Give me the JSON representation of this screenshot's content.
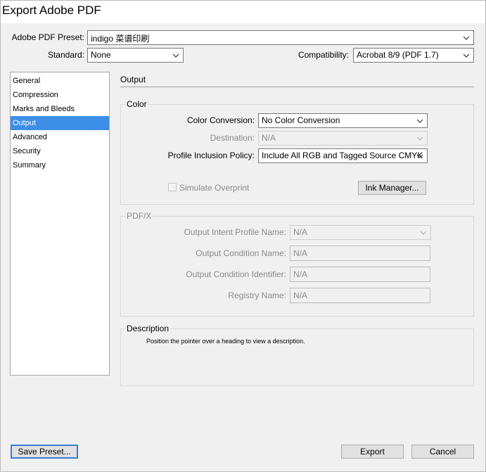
{
  "window": {
    "title": "Export Adobe PDF"
  },
  "top": {
    "preset_label": "Adobe PDF Preset:",
    "preset_value": "indigo 菜谱印刷",
    "standard_label": "Standard:",
    "standard_value": "None",
    "compat_label": "Compatibility:",
    "compat_value": "Acrobat 8/9 (PDF 1.7)"
  },
  "sidebar": {
    "items": [
      {
        "label": "General"
      },
      {
        "label": "Compression"
      },
      {
        "label": "Marks and Bleeds"
      },
      {
        "label": "Output"
      },
      {
        "label": "Advanced"
      },
      {
        "label": "Security"
      },
      {
        "label": "Summary"
      }
    ],
    "selected": "Output"
  },
  "main": {
    "section_title": "Output",
    "color": {
      "title": "Color",
      "conversion_label": "Color Conversion:",
      "conversion_value": "No Color Conversion",
      "destination_label": "Destination:",
      "destination_value": "N/A",
      "policy_label": "Profile Inclusion Policy:",
      "policy_value": "Include All RGB and Tagged Source CMYK",
      "simulate_label": "Simulate Overprint",
      "ink_button": "Ink Manager..."
    },
    "pdfx": {
      "title": "PDF/X",
      "intent_label": "Output Intent Profile Name:",
      "intent_value": "N/A",
      "cond_name_label": "Output Condition Name:",
      "cond_name_value": "N/A",
      "cond_id_label": "Output Condition Identifier:",
      "cond_id_value": "N/A",
      "registry_label": "Registry Name:",
      "registry_value": "N/A"
    },
    "description": {
      "title": "Description",
      "text": "Position the pointer over a heading to view a description."
    }
  },
  "footer": {
    "save_preset": "Save Preset...",
    "export": "Export",
    "cancel": "Cancel"
  }
}
